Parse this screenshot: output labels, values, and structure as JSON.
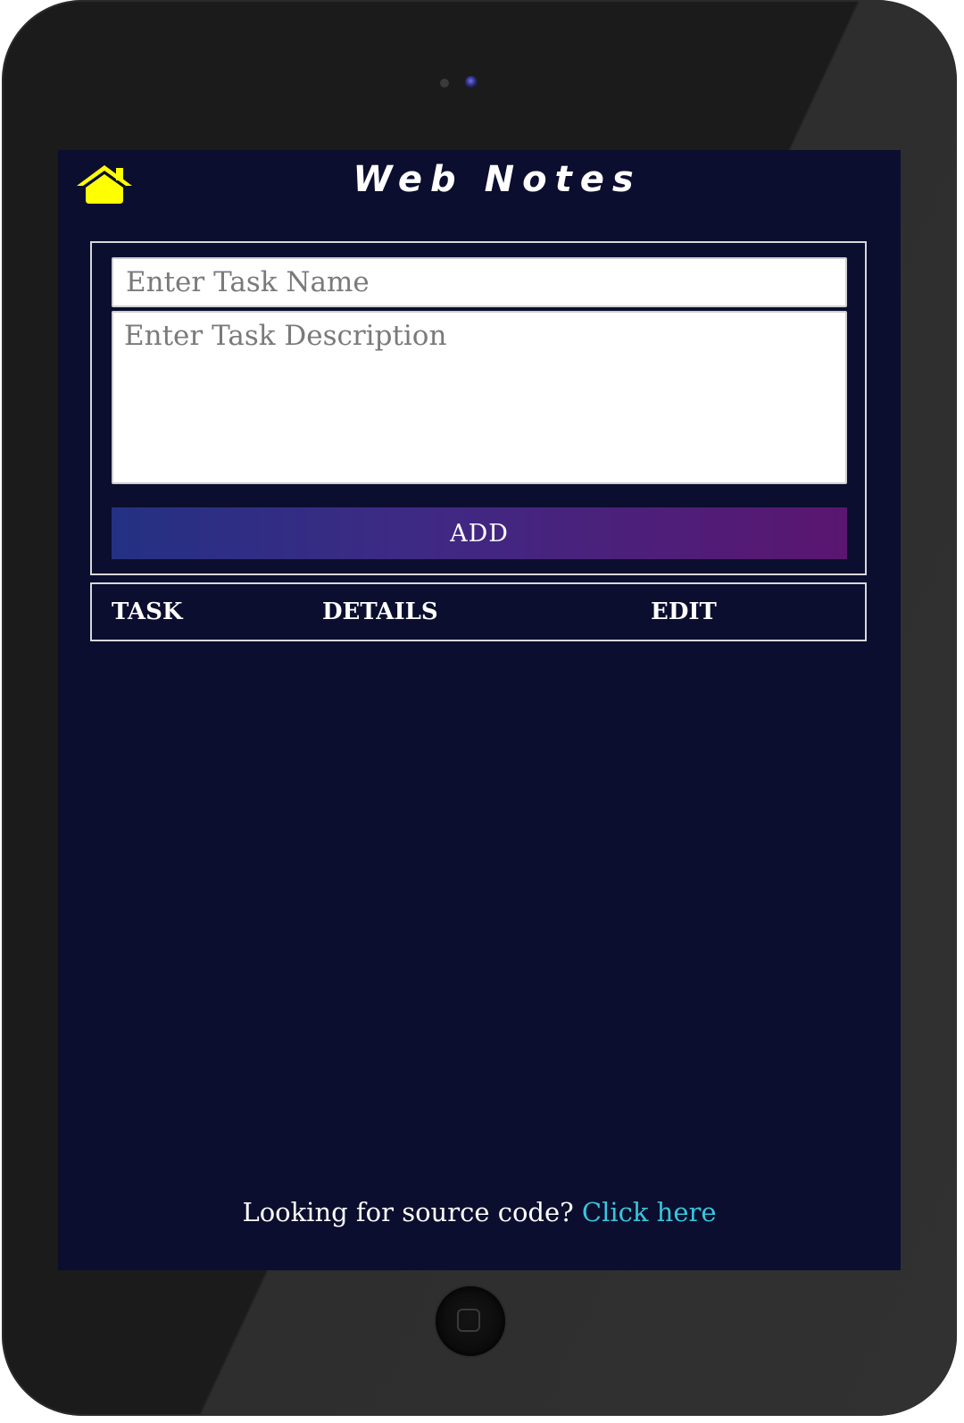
{
  "app": {
    "title": "Web Notes"
  },
  "form": {
    "task_name_placeholder": "Enter Task Name",
    "task_name_value": "",
    "task_desc_placeholder": "Enter Task Description",
    "task_desc_value": "",
    "add_label": "ADD"
  },
  "table": {
    "columns": [
      "TASK",
      "DETAILS",
      "EDIT"
    ],
    "rows": []
  },
  "footer": {
    "text": "Looking for source code?",
    "link_label": "Click here"
  },
  "icons": {
    "home": "home-icon"
  },
  "colors": {
    "screen_bg": "#0b0e2e",
    "home_icon": "#ffff00",
    "add_gradient_start": "#243183",
    "add_gradient_end": "#5a1670",
    "link": "#38c6dc",
    "border": "#d8d8d8"
  }
}
